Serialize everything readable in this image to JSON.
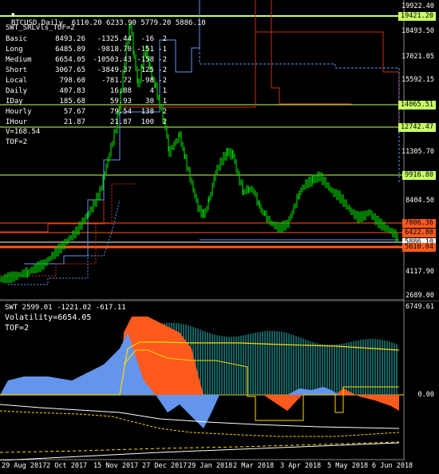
{
  "main_title": "BTCUSD,Daily  6110.20 6233.90 5779.20 5886.10",
  "indicator_name": "SWT_SRLvls_TOF=2",
  "levels_table": [
    {
      "name": "Basic",
      "v1": "8493.26",
      "v2": "-1325.44",
      "v3": "-16",
      "v4": "2"
    },
    {
      "name": "Long",
      "v1": "6485.89",
      "v2": "-9818.70",
      "v3": "-151",
      "v4": "-1"
    },
    {
      "name": "Medium",
      "v1": "6654.05",
      "v2": "-10503.43",
      "v3": "-158",
      "v4": "-2"
    },
    {
      "name": "Short",
      "v1": "3067.65",
      "v2": "-3849.37",
      "v3": "-125",
      "v4": "-2"
    },
    {
      "name": "Local",
      "v1": "798.60",
      "v2": "-781.72",
      "v3": "-98",
      "v4": "-2"
    },
    {
      "name": "Daily",
      "v1": "407.83",
      "v2": "16.88",
      "v3": "4",
      "v4": "1"
    },
    {
      "name": "IDay",
      "v1": "185.68",
      "v2": "59.93",
      "v3": "30",
      "v4": "1"
    },
    {
      "name": "Hourly",
      "v1": "57.67",
      "v2": "79.54",
      "v3": "138",
      "v4": "2"
    },
    {
      "name": "IHour",
      "v1": "21.87",
      "v2": "21.87",
      "v3": "100",
      "v4": "2"
    }
  ],
  "v_line": "V=168.54",
  "tof_line": "TOF=2",
  "price_axis": [
    "19922.40",
    "18493.50",
    "17021.05",
    "15592.15",
    "14065.51",
    "12742.47",
    "11305.70",
    "9916.80",
    "8404.50",
    "7006.36",
    "6422.80",
    "5886.10",
    "5610.04",
    "4117.90",
    "2689.00"
  ],
  "price_tags": [
    {
      "label": "19421.20",
      "bg": "#c8ff64",
      "fg": "#000"
    },
    {
      "label": "14065.51",
      "bg": "#c8ff64",
      "fg": "#000"
    },
    {
      "label": "12742.47",
      "bg": "#c8ff64",
      "fg": "#000"
    },
    {
      "label": "9916.80",
      "bg": "#c8ff64",
      "fg": "#000"
    },
    {
      "label": "7006.36",
      "bg": "#ff5a1e",
      "fg": "#000"
    },
    {
      "label": "6422.80",
      "bg": "#ff5a1e",
      "fg": "#000"
    },
    {
      "label": "5886.10",
      "bg": "#ffffff",
      "fg": "#000"
    },
    {
      "label": "5610.04",
      "bg": "#ff5a1e",
      "fg": "#000"
    }
  ],
  "sub_title": "SWT 2599.01 -1221.02 -617.11",
  "sub_volatility": "Volatility=6654.05",
  "sub_tof": "TOF=2",
  "sub_axis": [
    "6749.61",
    "0.00"
  ],
  "time_axis": [
    "29 Aug 2017",
    "2 Oct 2017",
    "15 Nov 2017",
    "27 Dec 2017",
    "29 Jan 2018",
    "2 Mar 2018",
    "3 Apr 2018",
    "5 May 2018",
    "6 Jun 2018"
  ],
  "colors": {
    "candle": "#00c800",
    "resistance": "#ff5a1e",
    "support_line": "#c8ff64",
    "band_blue": "#6495ed",
    "fill_orange": "#ff5a1e",
    "fill_teal": "#1e8c8c",
    "fill_blue": "#6495ed",
    "yellow": "#ffd700"
  }
}
